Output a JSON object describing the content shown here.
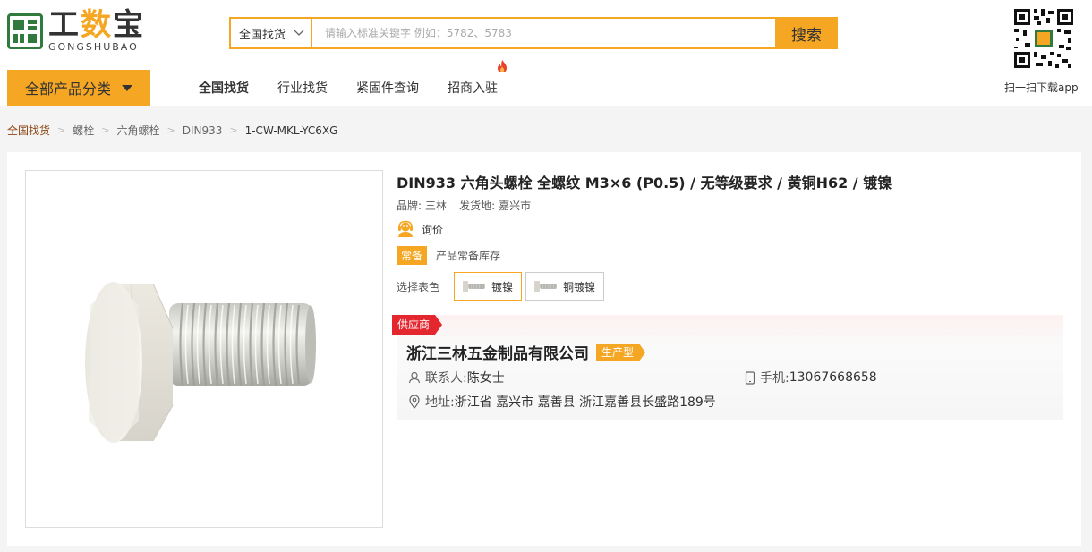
{
  "header": {
    "logo_cn_1": "工",
    "logo_cn_2": "数",
    "logo_cn_3": "宝",
    "logo_en": "GONGSHUBAO",
    "search": {
      "scope": "全国找货",
      "placeholder": "请输入标准关键字 例如：5782、5783",
      "button": "搜索"
    },
    "qr_caption": "扫一扫下载app",
    "all_categories": "全部产品分类",
    "nav": [
      "全国找货",
      "行业找货",
      "紧固件查询",
      "招商入驻"
    ]
  },
  "breadcrumb": [
    "全国找货",
    "螺栓",
    "六角螺栓",
    "DIN933",
    "1-CW-MKL-YC6XG"
  ],
  "product": {
    "title": "DIN933 六角头螺栓 全螺纹 M3×6 (P0.5) / 无等级要求 / 黄铜H62 / 镀镍",
    "brand_label": "品牌:",
    "brand": "三林",
    "origin_label": "发货地:",
    "origin": "嘉兴市",
    "inquiry": "询价",
    "stock_badge": "常备",
    "stock_text": "产品常备库存",
    "color_label": "选择表色",
    "colors": [
      "镀镍",
      "铜镀镍"
    ]
  },
  "supplier": {
    "tag": "供应商",
    "name": "浙江三林五金制品有限公司",
    "type": "生产型",
    "contact_label": "联系人:",
    "contact": "陈女士",
    "phone_label": "手机:",
    "phone": "13067668658",
    "address_label": "地址:",
    "address": "浙江省 嘉兴市 嘉善县 浙江嘉善县长盛路189号"
  },
  "colors": {
    "accent": "#f5a623",
    "brand_green": "#2f7a3c",
    "supplier_red": "#e4262e"
  }
}
